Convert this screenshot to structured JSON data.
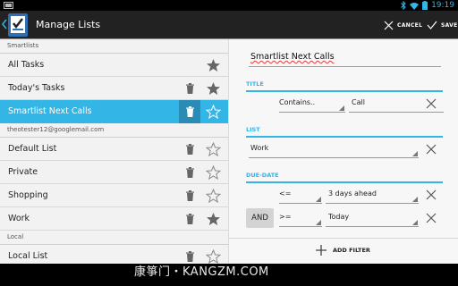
{
  "statusbar": {
    "time": "19:19"
  },
  "actionbar": {
    "title": "Manage Lists",
    "cancel_label": "CANCEL",
    "save_label": "SAVE"
  },
  "lists": {
    "sections": [
      {
        "header": "Smartlists",
        "items": [
          {
            "label": "All Tasks",
            "trash": false,
            "star": "filled",
            "selected": false
          },
          {
            "label": "Today's Tasks",
            "trash": true,
            "star": "filled",
            "selected": false
          },
          {
            "label": "Smartlist Next Calls",
            "trash": true,
            "star": "outline",
            "selected": true
          }
        ]
      },
      {
        "header": "theotester12@googlemail.com",
        "items": [
          {
            "label": "Default List",
            "trash": true,
            "star": "outline",
            "selected": false
          },
          {
            "label": "Private",
            "trash": true,
            "star": "outline",
            "selected": false
          },
          {
            "label": "Shopping",
            "trash": true,
            "star": "outline",
            "selected": false
          },
          {
            "label": "Work",
            "trash": true,
            "star": "filled",
            "selected": false
          }
        ]
      },
      {
        "header": "Local",
        "items": [
          {
            "label": "Local List",
            "trash": true,
            "star": "outline",
            "selected": false
          }
        ]
      }
    ]
  },
  "editor": {
    "name": "Smartlist Next Calls",
    "title_section": {
      "label": "TITLE",
      "operator": "Contains..",
      "value": "Call"
    },
    "list_section": {
      "label": "LIST",
      "value": "Work"
    },
    "due_section": {
      "label": "DUE-DATE",
      "rows": [
        {
          "operator": "<=",
          "value": "3 days ahead"
        },
        {
          "connector": "AND",
          "operator": ">=",
          "value": "Today"
        }
      ]
    },
    "add_filter_label": "ADD FILTER"
  },
  "watermark": "康箏门・KANGZM.COM",
  "colors": {
    "accent": "#33b5e5",
    "selected_row": "#33b5e5",
    "actionbar": "#222222"
  }
}
